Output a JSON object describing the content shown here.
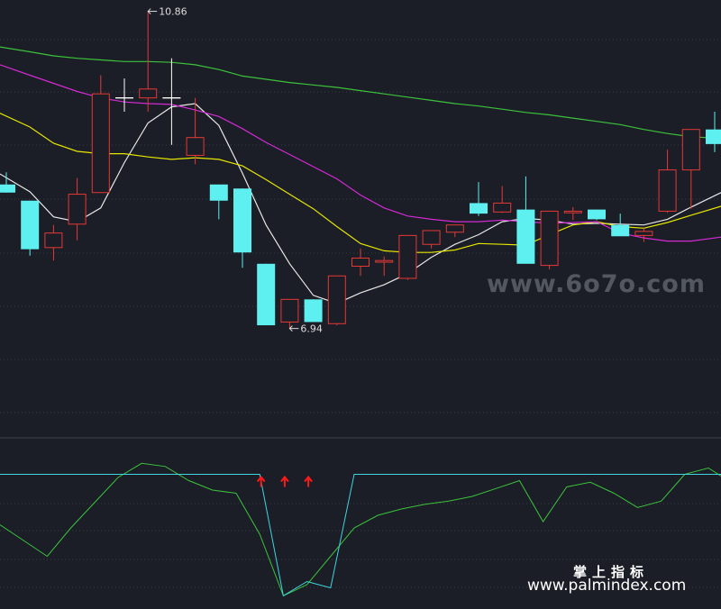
{
  "colors": {
    "background": "#1b1e26",
    "up": "#e53935",
    "down": "#5ef0f0",
    "ma_white": "#e8e8e8",
    "ma_yellow": "#e6e600",
    "ma_magenta": "#d42ad4",
    "ma_green": "#3cc23c",
    "osc_green": "#3cc23c",
    "osc_cyan": "#3fd6e0",
    "arrow": "#ff1a1a",
    "grid": "#3a3f4a",
    "divider": "#3c414c",
    "label": "#dddddd"
  },
  "watermarks": {
    "site1": "www.6o7o.com",
    "title_cn": "掌上指标",
    "site2": "www.palmindex.com"
  },
  "chart_data": [
    {
      "type": "candlestick",
      "price_range": [
        5.6,
        11.0
      ],
      "annotations": [
        {
          "label": "10.86",
          "candle": 6,
          "price": 10.86
        },
        {
          "label": "6.94",
          "candle": 12,
          "price": 6.94
        }
      ],
      "candles": [
        {
          "o": 8.72,
          "h": 8.87,
          "l": 8.62,
          "c": 8.62
        },
        {
          "o": 8.52,
          "h": 8.52,
          "l": 7.84,
          "c": 7.92
        },
        {
          "o": 7.94,
          "h": 8.22,
          "l": 7.78,
          "c": 8.12
        },
        {
          "o": 8.23,
          "h": 8.8,
          "l": 8.03,
          "c": 8.6
        },
        {
          "o": 8.62,
          "h": 10.07,
          "l": 8.62,
          "c": 9.84
        },
        {
          "o": 9.79,
          "h": 10.03,
          "l": 9.62,
          "c": 9.79
        },
        {
          "o": 9.79,
          "h": 10.86,
          "l": 9.62,
          "c": 9.9
        },
        {
          "o": 9.79,
          "h": 10.28,
          "l": 9.21,
          "c": 9.79
        },
        {
          "o": 9.08,
          "h": 9.79,
          "l": 8.97,
          "c": 9.3
        },
        {
          "o": 8.72,
          "h": 8.72,
          "l": 8.29,
          "c": 8.52
        },
        {
          "o": 8.67,
          "h": 8.67,
          "l": 7.69,
          "c": 7.88
        },
        {
          "o": 7.74,
          "h": 7.74,
          "l": 6.98,
          "c": 6.98
        },
        {
          "o": 7.02,
          "h": 7.27,
          "l": 6.94,
          "c": 7.3
        },
        {
          "o": 7.3,
          "h": 7.3,
          "l": 7.07,
          "c": 7.02
        },
        {
          "o": 7.0,
          "h": 7.56,
          "l": 6.98,
          "c": 7.59
        },
        {
          "o": 7.71,
          "h": 7.93,
          "l": 7.59,
          "c": 7.81
        },
        {
          "o": 7.76,
          "h": 7.83,
          "l": 7.59,
          "c": 7.78
        },
        {
          "o": 7.56,
          "h": 8.06,
          "l": 7.54,
          "c": 8.09
        },
        {
          "o": 7.98,
          "h": 8.13,
          "l": 7.93,
          "c": 8.15
        },
        {
          "o": 8.13,
          "h": 8.17,
          "l": 8.07,
          "c": 8.22
        },
        {
          "o": 8.49,
          "h": 8.75,
          "l": 8.33,
          "c": 8.36
        },
        {
          "o": 8.38,
          "h": 8.7,
          "l": 8.37,
          "c": 8.49
        },
        {
          "o": 8.41,
          "h": 8.82,
          "l": 7.8,
          "c": 7.74
        },
        {
          "o": 7.72,
          "h": 8.39,
          "l": 7.67,
          "c": 8.39
        },
        {
          "o": 8.37,
          "h": 8.44,
          "l": 8.28,
          "c": 8.39
        },
        {
          "o": 8.41,
          "h": 8.41,
          "l": 8.28,
          "c": 8.29
        },
        {
          "o": 8.22,
          "h": 8.36,
          "l": 8.1,
          "c": 8.08
        },
        {
          "o": 8.09,
          "h": 8.18,
          "l": 8.01,
          "c": 8.14
        },
        {
          "o": 8.39,
          "h": 9.15,
          "l": 8.37,
          "c": 8.9
        },
        {
          "o": 8.9,
          "h": 9.3,
          "l": 8.42,
          "c": 9.4
        },
        {
          "o": 9.4,
          "h": 9.62,
          "l": 9.12,
          "c": 9.22
        }
      ],
      "moving_averages": [
        {
          "color_key": "ma_white",
          "values": [
            8.85,
            8.63,
            8.32,
            8.26,
            8.43,
            8.99,
            9.48,
            9.68,
            9.72,
            9.45,
            8.86,
            8.22,
            7.74,
            7.35,
            7.25,
            7.38,
            7.48,
            7.62,
            7.82,
            7.98,
            8.1,
            8.26,
            8.3,
            8.28,
            8.23,
            8.24,
            8.23,
            8.22,
            8.29,
            8.44,
            8.62
          ]
        },
        {
          "color_key": "ma_yellow",
          "values": [
            9.6,
            9.43,
            9.23,
            9.13,
            9.1,
            9.1,
            9.06,
            9.03,
            9.05,
            9.03,
            8.95,
            8.78,
            8.6,
            8.42,
            8.2,
            7.99,
            7.9,
            7.88,
            7.88,
            7.91,
            7.99,
            7.98,
            7.97,
            8.1,
            8.22,
            8.26,
            8.2,
            8.18,
            8.25,
            8.34,
            8.45
          ]
        },
        {
          "color_key": "ma_magenta",
          "values": [
            10.2,
            10.07,
            9.97,
            9.87,
            9.79,
            9.74,
            9.72,
            9.71,
            9.64,
            9.56,
            9.41,
            9.24,
            9.09,
            8.94,
            8.79,
            8.59,
            8.43,
            8.33,
            8.29,
            8.26,
            8.26,
            8.28,
            8.26,
            8.24,
            8.25,
            8.26,
            8.12,
            8.06,
            8.02,
            8.02,
            8.07
          ]
        },
        {
          "color_key": "ma_green",
          "values": [
            10.42,
            10.36,
            10.31,
            10.28,
            10.26,
            10.24,
            10.24,
            10.23,
            10.2,
            10.14,
            10.06,
            10.02,
            9.98,
            9.95,
            9.92,
            9.88,
            9.84,
            9.8,
            9.76,
            9.72,
            9.69,
            9.65,
            9.61,
            9.58,
            9.54,
            9.5,
            9.46,
            9.4,
            9.35,
            9.31,
            9.29
          ]
        }
      ]
    },
    {
      "type": "line",
      "y_range": [
        0,
        100
      ],
      "cap": 82,
      "series": [
        {
          "color_key": "osc_green",
          "values": [
            50,
            40,
            30,
            48,
            64,
            80,
            89,
            87,
            78,
            72,
            70,
            44,
            5,
            12,
            30,
            48,
            56,
            60,
            63,
            65,
            68,
            73,
            78,
            52,
            74,
            77,
            70,
            61,
            65,
            82,
            86,
            81
          ]
        },
        {
          "color_key": "osc_cyan",
          "values": [
            82,
            82,
            82,
            82,
            82,
            82,
            82,
            82,
            82,
            82,
            82,
            82,
            5,
            14,
            10,
            82,
            82,
            82,
            82,
            82,
            82,
            82,
            82,
            82,
            82,
            82,
            82,
            82,
            82,
            82,
            82,
            82
          ]
        }
      ],
      "signal_arrows": [
        11,
        12,
        13
      ]
    }
  ]
}
